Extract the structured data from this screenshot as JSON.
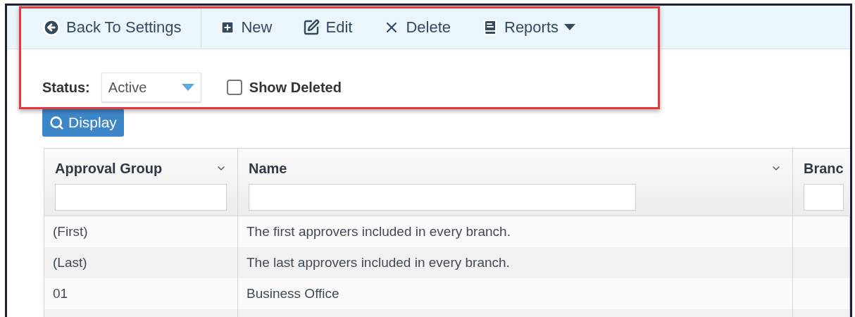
{
  "toolbar": {
    "back": "Back To Settings",
    "actions": [
      {
        "kind": "new",
        "label": "New"
      },
      {
        "kind": "edit",
        "label": "Edit"
      },
      {
        "kind": "delete",
        "label": "Delete"
      },
      {
        "kind": "reports",
        "label": "Reports"
      }
    ]
  },
  "filters": {
    "status_label": "Status:",
    "status_value": "Active",
    "show_deleted": {
      "label": "Show Deleted",
      "checked": false
    }
  },
  "display_button": "Display",
  "table": {
    "columns": [
      {
        "label": "Approval Group",
        "menu": true
      },
      {
        "label": "Name",
        "menu": true
      },
      {
        "label": "Branc",
        "menu": false
      }
    ],
    "rows": [
      [
        "(First)",
        "The first approvers included in every branch."
      ],
      [
        "(Last)",
        "The last approvers included in every branch."
      ],
      [
        "01",
        "Business Office"
      ]
    ]
  }
}
